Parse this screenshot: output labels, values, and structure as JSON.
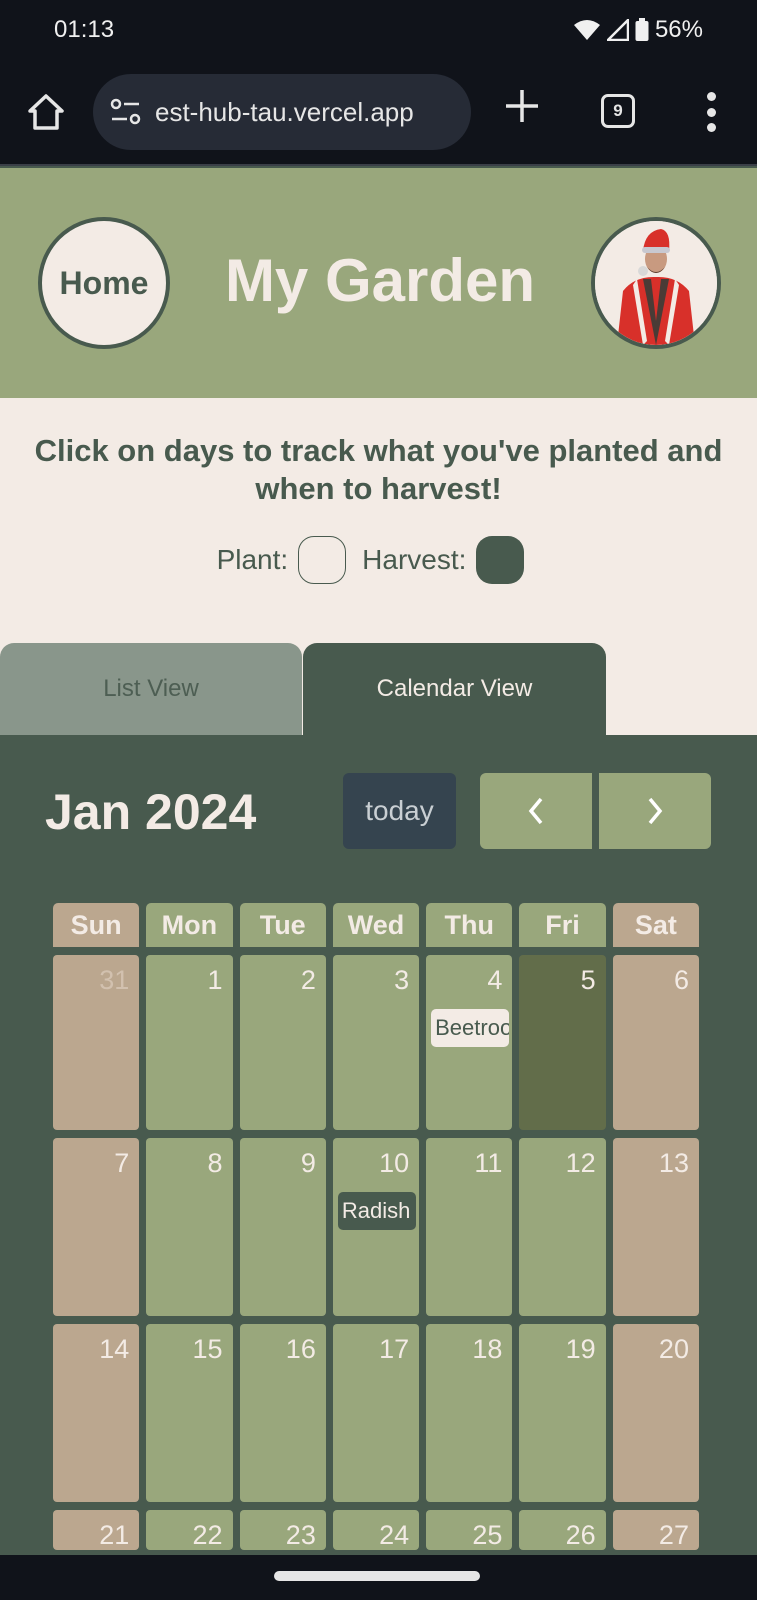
{
  "status_bar": {
    "time": "01:13",
    "battery": "56%",
    "icons": [
      "wifi-icon",
      "cell-signal-icon",
      "battery-icon"
    ]
  },
  "browser": {
    "url": "est-hub-tau.vercel.app",
    "tab_count": "9",
    "icons": [
      "home-icon",
      "site-settings-icon",
      "new-tab-icon",
      "tabs-icon",
      "more-menu-icon"
    ]
  },
  "header": {
    "home_label": "Home",
    "title": "My Garden",
    "avatar_alt": "user-avatar"
  },
  "intro": {
    "text": "Click on days to track what you've planted and when to harvest!",
    "legend": {
      "plant_label": "Plant:",
      "harvest_label": "Harvest:"
    }
  },
  "tabs": [
    {
      "label": "List View",
      "active": false
    },
    {
      "label": "Calendar View",
      "active": true
    }
  ],
  "calendar": {
    "month_title": "Jan 2024",
    "today_label": "today",
    "prev_icon": "chevron-left-icon",
    "next_icon": "chevron-right-icon",
    "days_of_week": [
      "Sun",
      "Mon",
      "Tue",
      "Wed",
      "Thu",
      "Fri",
      "Sat"
    ],
    "weeks": [
      [
        {
          "day": "31",
          "other_month": true
        },
        {
          "day": "1"
        },
        {
          "day": "2"
        },
        {
          "day": "3"
        },
        {
          "day": "4",
          "event": {
            "label": "Beetroot",
            "type": "plant"
          }
        },
        {
          "day": "5",
          "today": true
        },
        {
          "day": "6"
        }
      ],
      [
        {
          "day": "7"
        },
        {
          "day": "8"
        },
        {
          "day": "9"
        },
        {
          "day": "10",
          "event": {
            "label": "Radish",
            "type": "harvest"
          }
        },
        {
          "day": "11"
        },
        {
          "day": "12"
        },
        {
          "day": "13"
        }
      ],
      [
        {
          "day": "14"
        },
        {
          "day": "15"
        },
        {
          "day": "16"
        },
        {
          "day": "17"
        },
        {
          "day": "18"
        },
        {
          "day": "19"
        },
        {
          "day": "20"
        }
      ],
      [
        {
          "day": "21"
        },
        {
          "day": "22"
        },
        {
          "day": "23"
        },
        {
          "day": "24"
        },
        {
          "day": "25"
        },
        {
          "day": "26"
        },
        {
          "day": "27"
        }
      ]
    ]
  },
  "colors": {
    "header_green": "#99a77c",
    "dark_green": "#485a4e",
    "cream": "#f3ebe5",
    "weekend_tan": "#bba78f",
    "today_olive": "#626d4a",
    "today_button": "#35444f"
  }
}
